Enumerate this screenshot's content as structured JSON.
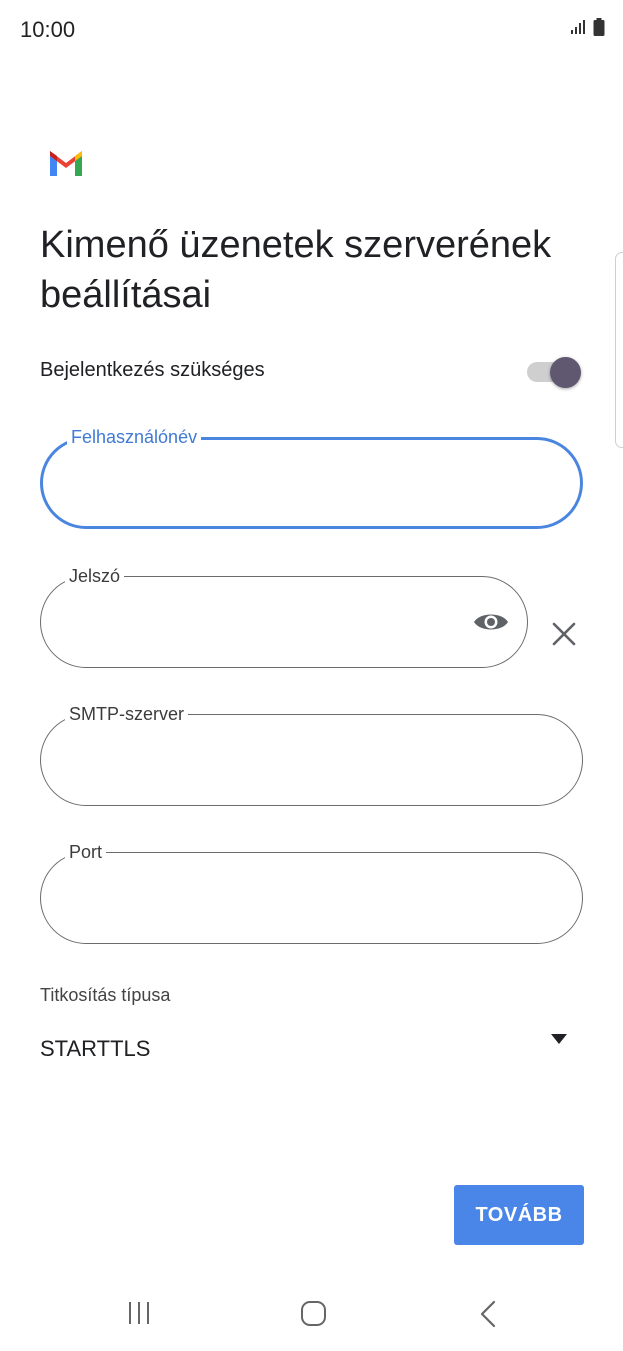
{
  "status_bar": {
    "time": "10:00"
  },
  "header": {
    "logo_icon": "gmail-logo",
    "title": "Kimenő üzenetek szerverének beállításai"
  },
  "login_required": {
    "label": "Bejelentkezés szükséges",
    "enabled": true
  },
  "fields": {
    "username": {
      "label": "Felhasználónév",
      "value": ""
    },
    "password": {
      "label": "Jelszó",
      "value": ""
    },
    "smtp_server": {
      "label": "SMTP-szerver",
      "value": ""
    },
    "port": {
      "label": "Port",
      "value": ""
    }
  },
  "encryption": {
    "label": "Titkosítás típusa",
    "selected": "STARTTLS"
  },
  "actions": {
    "next_label": "TOVÁBB"
  },
  "colors": {
    "accent": "#4a86e8",
    "focus": "#4a86e0",
    "toggle_thumb": "#5f5870"
  }
}
